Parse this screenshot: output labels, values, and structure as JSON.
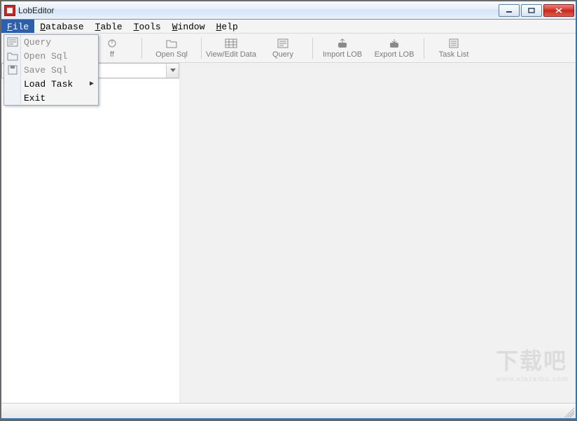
{
  "window": {
    "title": "LobEditor"
  },
  "menubar": {
    "items": [
      {
        "label": "File",
        "mnemonic": "F",
        "active": true
      },
      {
        "label": "Database",
        "mnemonic": "D"
      },
      {
        "label": "Table",
        "mnemonic": "T"
      },
      {
        "label": "Tools",
        "mnemonic": "T"
      },
      {
        "label": "Window",
        "mnemonic": "W"
      },
      {
        "label": "Help",
        "mnemonic": "H"
      }
    ]
  },
  "file_menu": {
    "items": [
      {
        "label": "Query",
        "icon": "query-icon",
        "disabled": true
      },
      {
        "label": "Open Sql",
        "icon": "open-icon",
        "disabled": true
      },
      {
        "label": "Save Sql",
        "icon": "save-icon",
        "disabled": true
      },
      {
        "label": "Load Task",
        "submenu": true,
        "disabled": false
      },
      {
        "label": "Exit",
        "disabled": false
      }
    ]
  },
  "toolbar": {
    "buttons": [
      {
        "label": "ff",
        "icon": "logoff-icon",
        "name": "toolbar-logoff"
      },
      {
        "label": "Open Sql",
        "icon": "open-icon",
        "name": "toolbar-open-sql"
      },
      {
        "label": "View/Edit Data",
        "icon": "table-icon",
        "name": "toolbar-view-edit"
      },
      {
        "label": "Query",
        "icon": "query-icon",
        "name": "toolbar-query"
      },
      {
        "label": "Import LOB",
        "icon": "import-icon",
        "name": "toolbar-import-lob"
      },
      {
        "label": "Export LOB",
        "icon": "export-icon",
        "name": "toolbar-export-lob"
      },
      {
        "label": "Task List",
        "icon": "tasklist-icon",
        "name": "toolbar-task-list"
      }
    ]
  },
  "watermark": {
    "main": "下载吧",
    "sub": "www.xiazaiba.com"
  }
}
